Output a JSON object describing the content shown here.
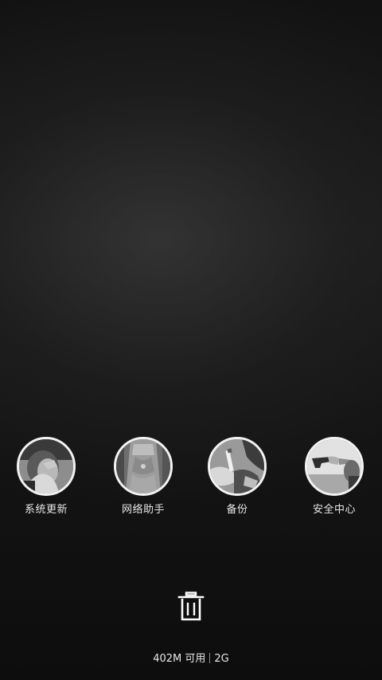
{
  "recent_apps": [
    {
      "label": "系统更新",
      "icon": "person-covering-face-photo"
    },
    {
      "label": "网络助手",
      "icon": "lace-dress-photo"
    },
    {
      "label": "备份",
      "icon": "hand-holding-cigarette-photo"
    },
    {
      "label": "安全中心",
      "icon": "hand-with-pistol-photo"
    }
  ],
  "clear_button": {
    "icon": "trash-icon"
  },
  "memory": {
    "available": "402M 可用",
    "total": "2G"
  }
}
